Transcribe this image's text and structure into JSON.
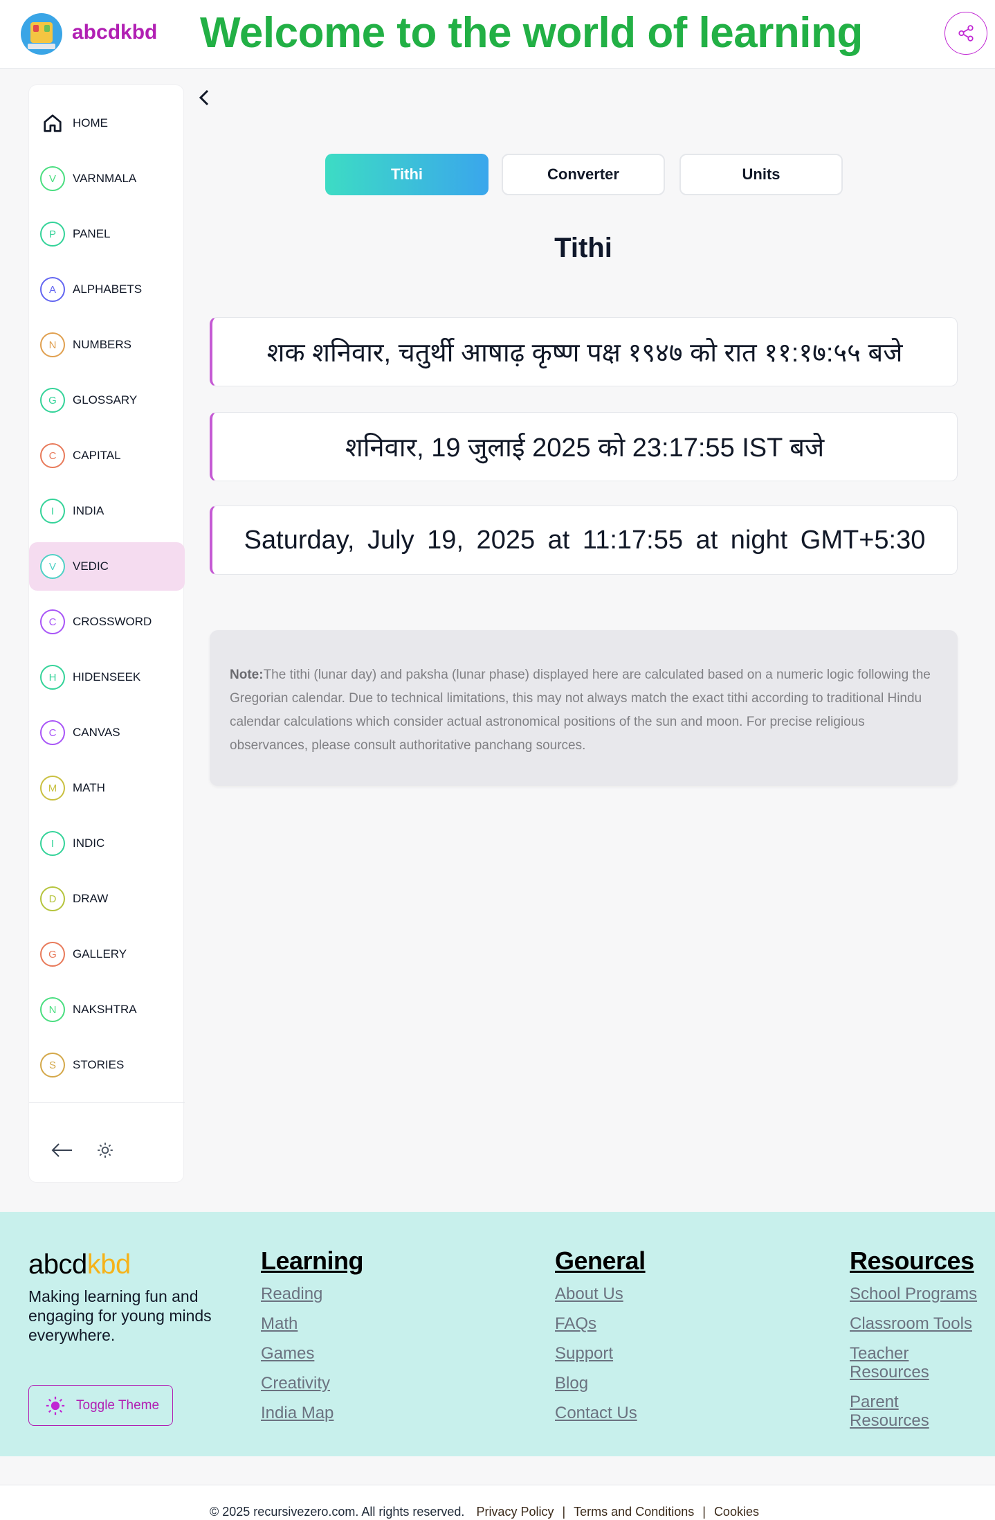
{
  "header": {
    "brand": "abcdkbd",
    "welcome": "Welcome to the world of learning"
  },
  "sidebar": {
    "items": [
      {
        "label": "HOME",
        "letter": "",
        "color": "#111827"
      },
      {
        "label": "VARNMALA",
        "letter": "V",
        "color": "#4ade80"
      },
      {
        "label": "PANEL",
        "letter": "P",
        "color": "#34d399"
      },
      {
        "label": "ALPHABETS",
        "letter": "A",
        "color": "#6366f1"
      },
      {
        "label": "NUMBERS",
        "letter": "N",
        "color": "#e0a050"
      },
      {
        "label": "GLOSSARY",
        "letter": "G",
        "color": "#34d399"
      },
      {
        "label": "CAPITAL",
        "letter": "C",
        "color": "#e87a5a"
      },
      {
        "label": "INDIA",
        "letter": "I",
        "color": "#34d399"
      },
      {
        "label": "VEDIC",
        "letter": "V",
        "color": "#4fd1c5"
      },
      {
        "label": "CROSSWORD",
        "letter": "C",
        "color": "#a855f7"
      },
      {
        "label": "HIDENSEEK",
        "letter": "H",
        "color": "#34d399"
      },
      {
        "label": "CANVAS",
        "letter": "C",
        "color": "#a855f7"
      },
      {
        "label": "MATH",
        "letter": "M",
        "color": "#c9c040"
      },
      {
        "label": "INDIC",
        "letter": "I",
        "color": "#34d399"
      },
      {
        "label": "DRAW",
        "letter": "D",
        "color": "#b5c43c"
      },
      {
        "label": "GALLERY",
        "letter": "G",
        "color": "#e87a5a"
      },
      {
        "label": "NAKSHTRA",
        "letter": "N",
        "color": "#4ade80"
      },
      {
        "label": "STORIES",
        "letter": "S",
        "color": "#d4a84a"
      }
    ],
    "active_index": 8
  },
  "tabs": [
    "Tithi",
    "Converter",
    "Units"
  ],
  "page_title": "Tithi",
  "dates": {
    "shaka": "शक शनिवार, चतुर्थी आषाढ़ कृष्ण पक्ष १९४७ को रात ११:१७:५५ बजे",
    "hindi": "शनिवार, 19 जुलाई 2025 को 23:17:55 IST बजे",
    "english": "Saturday, July 19, 2025 at 11:17:55 at night GMT+5:30"
  },
  "note": {
    "label": "Note:",
    "text": "The tithi (lunar day) and paksha (lunar phase) displayed here are calculated based on a numeric logic following the Gregorian calendar. Due to technical limitations, this may not always match the exact tithi according to traditional Hindu calendar calculations which consider actual astronomical positions of the sun and moon. For precise religious observances, please consult authoritative panchang sources."
  },
  "footer": {
    "brand_a": "abcd",
    "brand_b": "kbd",
    "tagline": "Making learning fun and engaging for young minds everywhere.",
    "toggle_theme": "Toggle Theme",
    "learning": {
      "title": "Learning",
      "links": [
        "Reading",
        "Math",
        "Games",
        "Creativity",
        "India Map"
      ]
    },
    "general": {
      "title": "General",
      "links": [
        "About Us",
        "FAQs",
        "Support",
        "Blog",
        "Contact Us"
      ]
    },
    "resources": {
      "title": "Resources",
      "links": [
        "School Programs",
        "Classroom Tools",
        "Teacher Resources",
        "Parent Resources"
      ]
    }
  },
  "copyright": {
    "text": "© 2025 recursivezero.com. All rights reserved.",
    "privacy": "Privacy Policy",
    "terms": "Terms and Conditions",
    "cookies": "Cookies",
    "sep": "|"
  }
}
